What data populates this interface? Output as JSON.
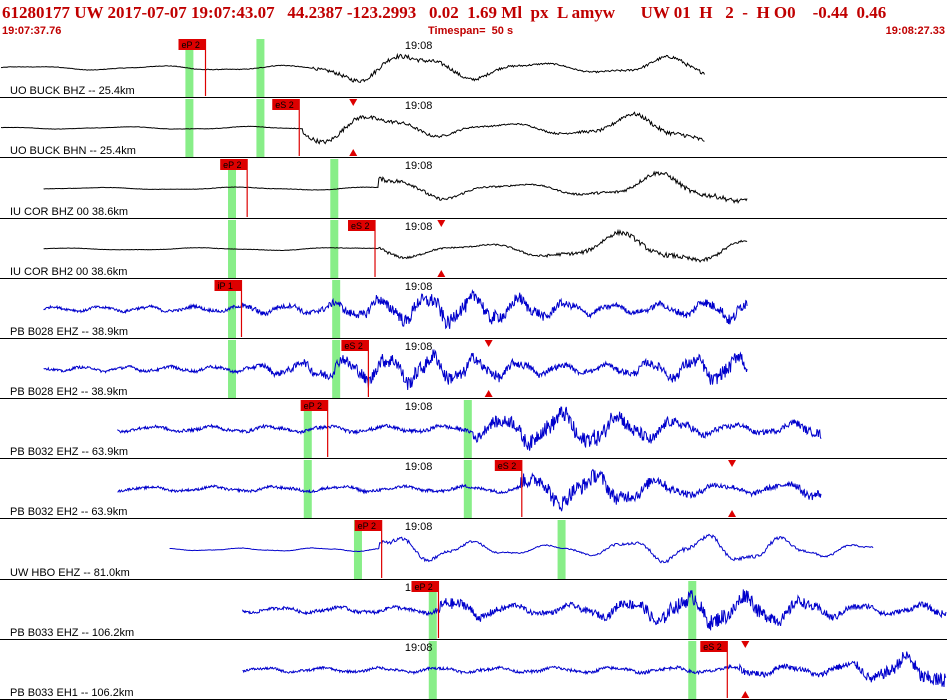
{
  "header": {
    "title": "61280177 UW 2017-07-07 19:07:43.07   44.2387 -123.2993   0.02  1.69 Ml  px  L amyw      UW 01  H   2  -  H O0    -0.44  0.46",
    "start_time": "19:07:37.76",
    "timespan_label": "Timespan=  50 s",
    "end_time": "19:08:27.33"
  },
  "time_marker_label": "19:08",
  "colors": {
    "text": "#c00000",
    "black_trace": "#000000",
    "blue_trace": "#0000cc",
    "pick": "#dd0000",
    "window": "#88ee88",
    "separator": "#000000"
  },
  "panels": [
    {
      "label": "UO BUCK BHZ -- 25.4km",
      "color": "black",
      "start": 0,
      "end": 0.745,
      "onset": 0.33,
      "amp": 0.55,
      "freq": 0.55,
      "noise": 0.08,
      "picks": [
        {
          "label": "eP 2",
          "x": 0.217
        }
      ],
      "windows": [
        0.2,
        0.275
      ],
      "triangles": []
    },
    {
      "label": "UO BUCK BHN -- 25.4km",
      "color": "black",
      "start": 0,
      "end": 0.745,
      "onset": 0.32,
      "amp": 0.55,
      "freq": 0.55,
      "noise": 0.04,
      "picks": [
        {
          "label": "eS 2",
          "x": 0.316
        }
      ],
      "windows": [
        0.2,
        0.275
      ],
      "triangles": [
        0.373
      ]
    },
    {
      "label": "IU COR BHZ 00 38.6km",
      "color": "black",
      "start": 0.045,
      "end": 0.79,
      "onset": 0.4,
      "amp": 0.6,
      "freq": 0.5,
      "noise": 0.04,
      "picks": [
        {
          "label": "eP 2",
          "x": 0.261
        }
      ],
      "windows": [
        0.245,
        0.353
      ],
      "triangles": []
    },
    {
      "label": "IU COR BH2 00 38.6km",
      "color": "black",
      "start": 0.045,
      "end": 0.79,
      "onset": 0.4,
      "amp": 0.6,
      "freq": 0.5,
      "noise": 0.04,
      "picks": [
        {
          "label": "eS 2",
          "x": 0.396
        }
      ],
      "windows": [
        0.245,
        0.353
      ],
      "triangles": [
        0.466
      ]
    },
    {
      "label": "PB B028 EHZ -- 38.9km",
      "color": "blue",
      "start": 0.045,
      "end": 0.79,
      "onset": 0.255,
      "amp": 0.5,
      "freq": 1.5,
      "noise": 0.1,
      "picks": [
        {
          "label": "iP 1",
          "x": 0.255
        }
      ],
      "windows": [
        0.245,
        0.355
      ],
      "triangles": []
    },
    {
      "label": "PB B028 EH2 -- 38.9km",
      "color": "blue",
      "start": 0.045,
      "end": 0.79,
      "onset": 0.27,
      "amp": 0.5,
      "freq": 1.6,
      "noise": 0.1,
      "picks": [
        {
          "label": "eS 2",
          "x": 0.389
        }
      ],
      "windows": [
        0.245,
        0.355
      ],
      "triangles": [
        0.516
      ]
    },
    {
      "label": "PB B032 EHZ -- 63.9km",
      "color": "blue",
      "start": 0.123,
      "end": 0.868,
      "onset": 0.5,
      "amp": 0.6,
      "freq": 1.2,
      "noise": 0.12,
      "picks": [
        {
          "label": "eP 2",
          "x": 0.346
        }
      ],
      "windows": [
        0.325,
        0.494
      ],
      "triangles": []
    },
    {
      "label": "PB B032 EH2 -- 63.9km",
      "color": "blue",
      "start": 0.123,
      "end": 0.868,
      "onset": 0.55,
      "amp": 0.55,
      "freq": 1.1,
      "noise": 0.1,
      "picks": [
        {
          "label": "eS 2",
          "x": 0.551
        }
      ],
      "windows": [
        0.325,
        0.494
      ],
      "triangles": [
        0.773
      ]
    },
    {
      "label": "UW HBO EHZ -- 81.0km",
      "color": "blue",
      "start": 0.178,
      "end": 0.923,
      "onset": 0.4,
      "amp": 0.5,
      "freq": 0.9,
      "noise": 0.05,
      "picks": [
        {
          "label": "eP 2",
          "x": 0.403
        }
      ],
      "windows": [
        0.378,
        0.593
      ],
      "triangles": []
    },
    {
      "label": "PB B033 EHZ -- 106.2km",
      "color": "blue",
      "start": 0.255,
      "end": 1.0,
      "onset": 0.46,
      "amp": 0.55,
      "freq": 1.2,
      "noise": 0.12,
      "picks": [
        {
          "label": "eP 2",
          "x": 0.463
        }
      ],
      "windows": [
        0.457,
        0.731
      ],
      "triangles": []
    },
    {
      "label": "PB B033 EH1 -- 106.2km",
      "color": "blue",
      "start": 0.255,
      "end": 1.0,
      "onset": 0.78,
      "amp": 0.6,
      "freq": 1.2,
      "noise": 0.1,
      "picks": [
        {
          "label": "eS 2",
          "x": 0.768
        }
      ],
      "windows": [
        0.457,
        0.731
      ],
      "triangles": [
        0.787
      ]
    }
  ],
  "time_marker_x": 0.455
}
